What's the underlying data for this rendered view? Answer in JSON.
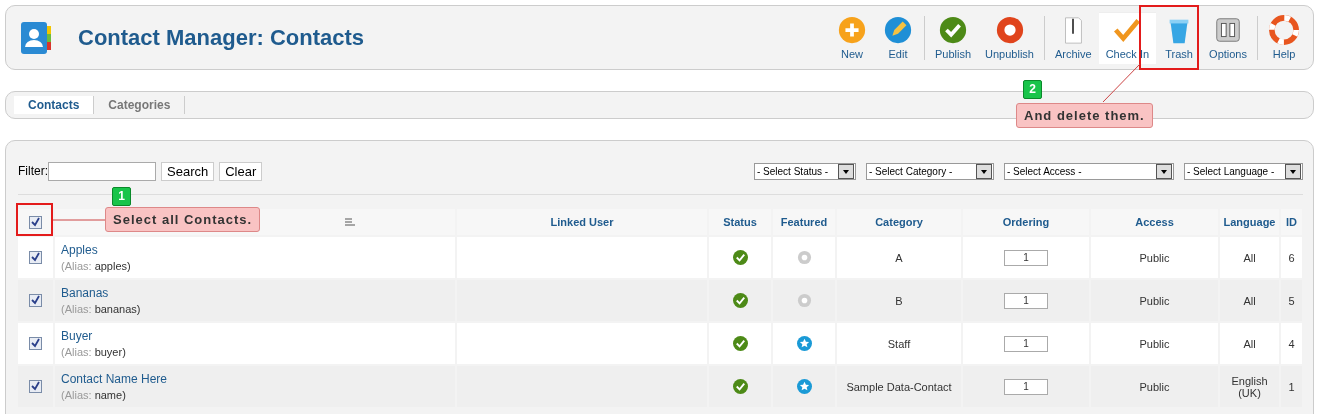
{
  "header": {
    "title": "Contact Manager: Contacts"
  },
  "toolbar": [
    {
      "buttons": [
        {
          "label": "New",
          "kind": "new",
          "hovered": false
        },
        {
          "label": "Edit",
          "kind": "edit",
          "hovered": false
        }
      ]
    },
    {
      "buttons": [
        {
          "label": "Publish",
          "kind": "publish",
          "hovered": false
        },
        {
          "label": "Unpublish",
          "kind": "unpublish",
          "hovered": false
        }
      ]
    },
    {
      "buttons": [
        {
          "label": "Archive",
          "kind": "archive",
          "hovered": false
        },
        {
          "label": "Check In",
          "kind": "checkin",
          "hovered": true
        },
        {
          "label": "Trash",
          "kind": "trash",
          "hovered": false,
          "highlighted": true
        },
        {
          "label": "Options",
          "kind": "options",
          "hovered": false
        }
      ]
    },
    {
      "buttons": [
        {
          "label": "Help",
          "kind": "help",
          "hovered": false
        }
      ]
    }
  ],
  "tabs": [
    {
      "label": "Contacts",
      "selected": true
    },
    {
      "label": "Categories",
      "selected": false
    }
  ],
  "filter": {
    "label": "Filter:",
    "buttons": [
      "Search",
      "Clear"
    ]
  },
  "selects": [
    "- Select Status -",
    "- Select Category -",
    "- Select Access -",
    "- Select Language -"
  ],
  "table": {
    "select_all": {
      "checked": true
    },
    "columns": [
      "Linked User",
      "Status",
      "Featured",
      "Category",
      "Ordering",
      "Access",
      "Language",
      "ID"
    ],
    "rows": [
      {
        "checked": true,
        "name": "Apples",
        "alias_label": "(Alias:",
        "alias": "apples)",
        "published": true,
        "featured": false,
        "category": "A",
        "ordering": "1",
        "access": "Public",
        "language": "All",
        "id": "6"
      },
      {
        "checked": true,
        "name": "Bananas",
        "alias_label": "(Alias:",
        "alias": "bananas)",
        "published": true,
        "featured": false,
        "category": "B",
        "ordering": "1",
        "access": "Public",
        "language": "All",
        "id": "5"
      },
      {
        "checked": true,
        "name": "Buyer",
        "alias_label": "(Alias:",
        "alias": "buyer)",
        "published": true,
        "featured": true,
        "category": "Staff",
        "ordering": "1",
        "access": "Public",
        "language": "All",
        "id": "4"
      },
      {
        "checked": true,
        "name": "Contact Name Here",
        "alias_label": "(Alias:",
        "alias": "name)",
        "published": true,
        "featured": true,
        "category": "Sample Data-Contact",
        "ordering": "1",
        "access": "Public",
        "language": "English (UK)",
        "id": "1"
      }
    ]
  },
  "callouts": [
    {
      "number": "1",
      "text": "Select all Contacts."
    },
    {
      "number": "2",
      "text": "And delete them."
    }
  ]
}
